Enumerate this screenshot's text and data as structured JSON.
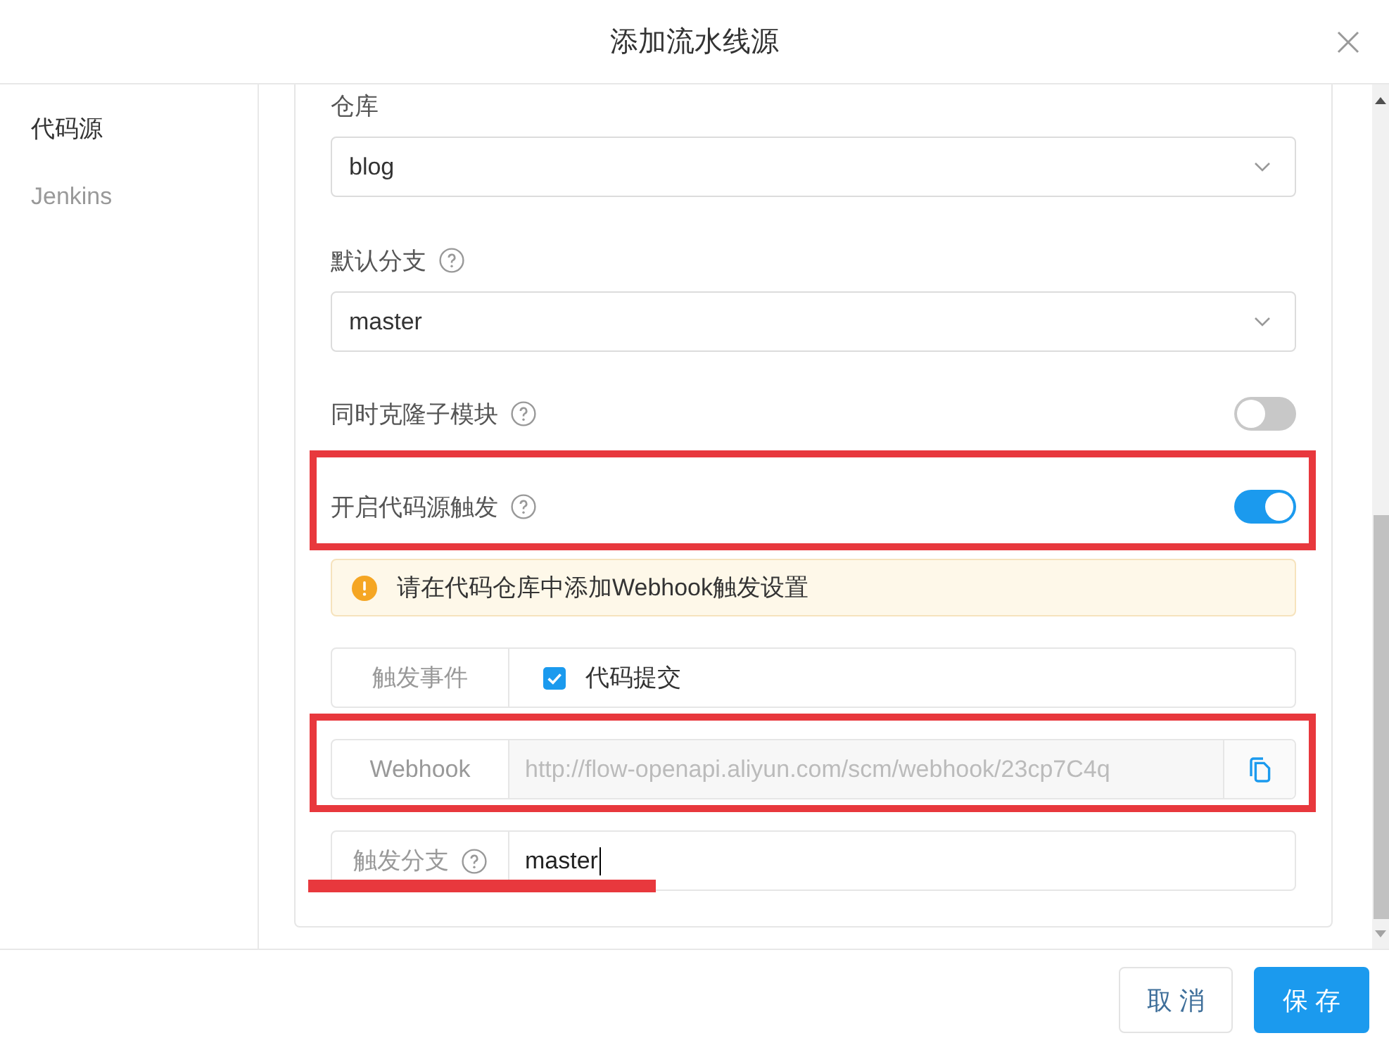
{
  "dialog": {
    "title": "添加流水线源"
  },
  "sidebar": {
    "items": [
      {
        "label": "代码源",
        "selected": true
      },
      {
        "label": "Jenkins",
        "selected": false
      }
    ]
  },
  "form": {
    "fields": [
      {
        "kind": "select",
        "label": "仓库",
        "help": false,
        "value": "blog"
      },
      {
        "kind": "select",
        "label": "默认分支",
        "help": true,
        "value": "master"
      },
      {
        "kind": "switch",
        "label": "同时克隆子模块",
        "help": true,
        "on": false
      },
      {
        "kind": "switch",
        "label": "开启代码源触发",
        "help": true,
        "on": true,
        "boxed": true
      },
      {
        "kind": "alert",
        "text": "请在代码仓库中添加Webhook触发设置"
      },
      {
        "kind": "checkbox_group",
        "label": "触发事件",
        "help": false,
        "options": [
          {
            "label": "代码提交",
            "checked": true
          }
        ]
      },
      {
        "kind": "copy_field",
        "label": "Webhook",
        "help": false,
        "value": "http://flow-openapi.aliyun.com/scm/webhook/23cp7C4q",
        "disabled": true,
        "boxed": true
      },
      {
        "kind": "text_input",
        "label": "触发分支",
        "help": true,
        "value": "master",
        "focused": true,
        "underlined": true
      }
    ]
  },
  "footer": {
    "buttons": [
      {
        "label": "取消",
        "kind": "secondary"
      },
      {
        "label": "保存",
        "kind": "primary"
      }
    ]
  }
}
